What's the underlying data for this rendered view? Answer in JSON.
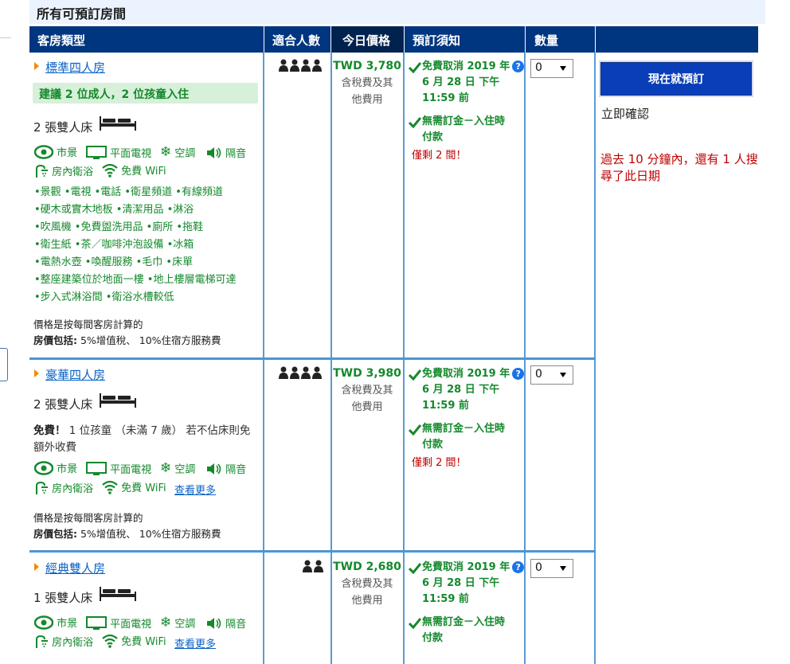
{
  "section_title": "所有可預訂房間",
  "headers": {
    "room_type": "客房類型",
    "sleeps": "適合人數",
    "price": "今日價格",
    "policies": "預訂須知",
    "quantity": "數量"
  },
  "rooms": [
    {
      "name": "標準四人房",
      "suggestion": "建議 2 位成人，2 位孩童入住",
      "bed": "2 張雙人床",
      "occupancy": 4,
      "price": "TWD 3,780",
      "tax_line1": "含稅費及其",
      "tax_line2": "他費用",
      "policy1_line1": "免費取消 2019 年",
      "policy1_line2": "6 月 28 日 下午",
      "policy1_line3": "11:59 前",
      "policy2_line1": "無需訂金－入住時",
      "policy2_line2": "付款",
      "rooms_left": "僅剩 2 間！",
      "qty": "0",
      "facilities": {
        "view": "市景",
        "tv": "平面電視",
        "ac": "空調",
        "soundproof": "隔音",
        "bath": "房內衛浴",
        "wifi": "免費 WiFi"
      },
      "amenity_lines": [
        "•景觀  •電視  •電話  •衛星頻道  •有線頻道",
        "•硬木或實木地板  •清潔用品  •淋浴",
        "•吹風機  •免費盥洗用品  •廁所  •拖鞋",
        "•衛生紙  •茶／咖啡沖泡設備  •冰箱",
        "•電熱水壺  •喚醒服務  •毛巾  •床單",
        "•整座建築位於地面一樓  •地上樓層電梯可達",
        "•步入式淋浴間  •衛浴水槽較低"
      ],
      "price_note": "價格是按每間客房計算的",
      "includes_label": "房價包括:",
      "includes_text": " 5%增值稅、 10%住宿方服務費"
    },
    {
      "name": "豪華四人房",
      "bed": "2 張雙人床",
      "occupancy": 4,
      "free_label": "免費！",
      "free_text": " 1 位孩童 （未滿 7 歲） 若不佔床則免額外收費",
      "price": "TWD 3,980",
      "tax_line1": "含稅費及其",
      "tax_line2": "他費用",
      "policy1_line1": "免費取消 2019 年",
      "policy1_line2": "6 月 28 日 下午",
      "policy1_line3": "11:59 前",
      "policy2_line1": "無需訂金－入住時",
      "policy2_line2": "付款",
      "rooms_left": "僅剩 2 間！",
      "qty": "0",
      "facilities": {
        "view": "市景",
        "tv": "平面電視",
        "ac": "空調",
        "soundproof": "隔音",
        "bath": "房內衛浴",
        "wifi": "免費 WiFi",
        "more": "查看更多"
      },
      "price_note": "價格是按每間客房計算的",
      "includes_label": "房價包括:",
      "includes_text": " 5%增值稅、 10%住宿方服務費"
    },
    {
      "name": "經典雙人房",
      "bed": "1 張雙人床",
      "occupancy": 2,
      "price": "TWD 2,680",
      "tax_line1": "含稅費及其",
      "tax_line2": "他費用",
      "policy1_line1": "免費取消 2019 年",
      "policy1_line2": "6 月 28 日 下午",
      "policy1_line3": "11:59 前",
      "policy2_line1": "無需訂金－入住時",
      "policy2_line2": "付款",
      "qty": "0",
      "facilities": {
        "view": "市景",
        "tv": "平面電視",
        "ac": "空調",
        "soundproof": "隔音",
        "bath": "房內衛浴",
        "wifi": "免費 WiFi",
        "more": "查看更多"
      }
    }
  ],
  "sidebar": {
    "book_button": "現在就預訂",
    "instant_confirm": "立即確認",
    "search_note": "過去 10 分鐘內，還有 1 人搜尋了此日期"
  },
  "colors": {
    "header_bg": "#003580",
    "header_active_bg": "#00224f",
    "green": "#14892c",
    "link_blue": "#0a62c7",
    "alert_red": "#c00000",
    "button_blue": "#0a3eb8",
    "title_bg": "#ebf3ff"
  }
}
